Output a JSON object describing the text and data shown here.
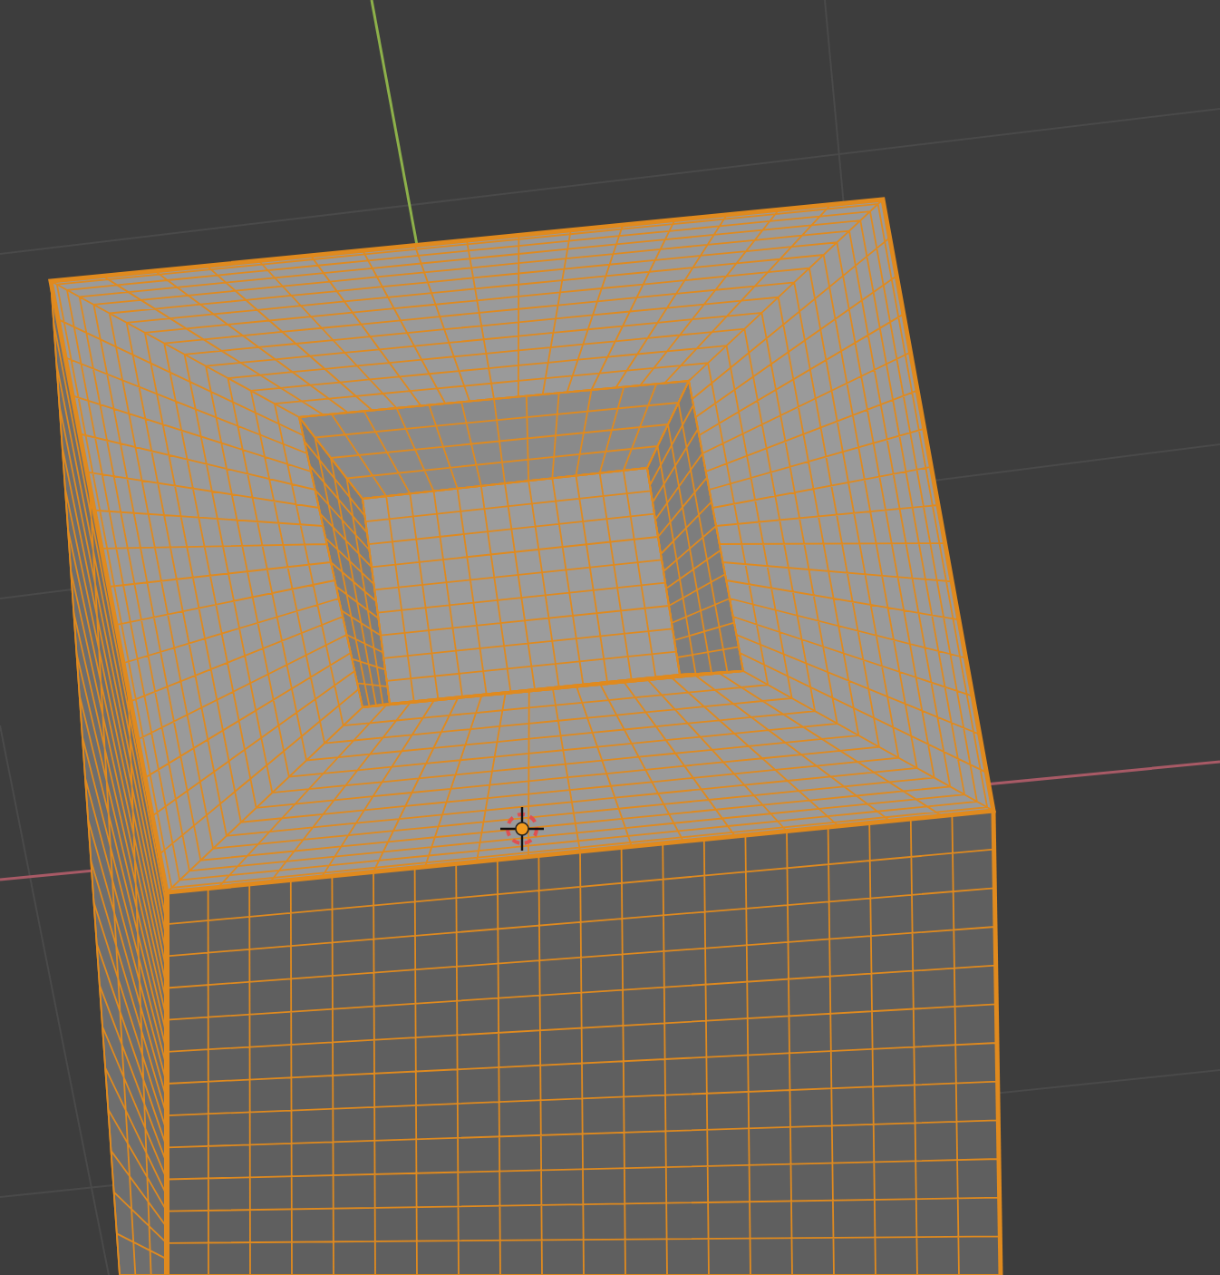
{
  "viewport": {
    "mesh": {
      "selected": true
    }
  }
}
